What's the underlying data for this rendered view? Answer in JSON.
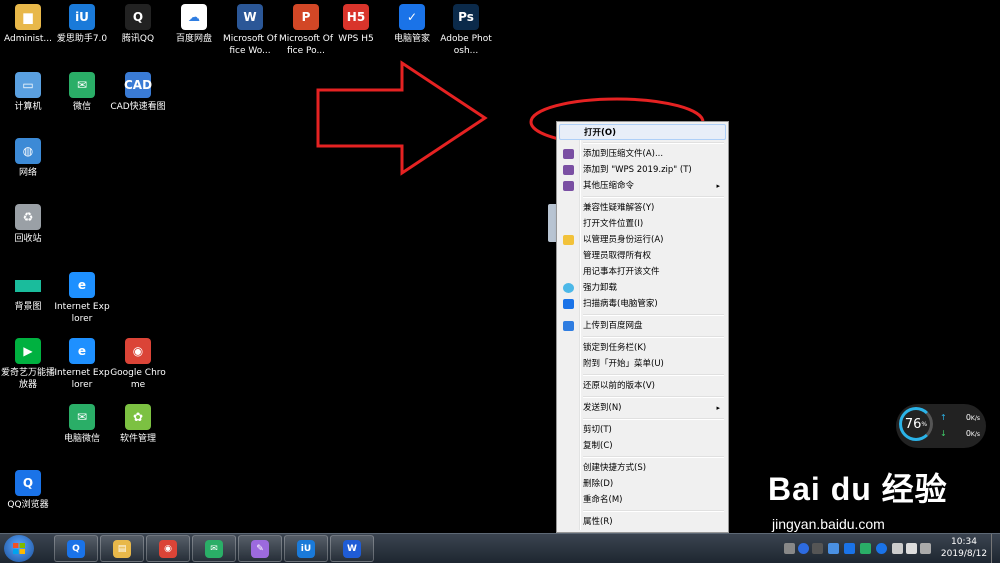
{
  "desktop_icons": [
    {
      "label": "Administ...",
      "icon": "folder-icon",
      "color": "#e8b84a"
    },
    {
      "label": "爱思助手7.0",
      "icon": "i4-icon",
      "color": "#1a7ad9"
    },
    {
      "label": "腾讯QQ",
      "icon": "qq-icon",
      "color": "#222222"
    },
    {
      "label": "百度网盘",
      "icon": "baidu-netdisk-icon",
      "color": "#ffffff"
    },
    {
      "label": "Microsoft Office Wo...",
      "icon": "word-icon",
      "color": "#2b5797"
    },
    {
      "label": "Microsoft Office Po...",
      "icon": "powerpoint-icon",
      "color": "#d24726"
    },
    {
      "label": "WPS H5",
      "icon": "wps-h5-icon",
      "color": "#d9342b"
    },
    {
      "label": "电脑管家",
      "icon": "pc-manager-icon",
      "color": "#1a73e8"
    },
    {
      "label": "Adobe Photosh...",
      "icon": "photoshop-icon",
      "color": "#0b2a4a"
    },
    {
      "label": "计算机",
      "icon": "computer-icon",
      "color": "#5aa0e0"
    },
    {
      "label": "微信",
      "icon": "wechat-icon",
      "color": "#2aae67"
    },
    {
      "label": "CAD快速看图",
      "icon": "cad-icon",
      "color": "#3a7bd5"
    },
    {
      "label": "网络",
      "icon": "network-icon",
      "color": "#3c8ad6"
    },
    {
      "label": "回收站",
      "icon": "recycle-bin-icon",
      "color": "#9aa0a6"
    },
    {
      "label": "背景图",
      "icon": "image-icon",
      "color": "#1abc9c"
    },
    {
      "label": "Internet Explorer",
      "icon": "ie-icon",
      "color": "#1e90ff"
    },
    {
      "label": "爱奇艺万能播放器",
      "icon": "iqiyi-icon",
      "color": "#00b140"
    },
    {
      "label": "Internet Explorer",
      "icon": "ie-icon",
      "color": "#1e90ff"
    },
    {
      "label": "Google Chrome",
      "icon": "chrome-icon",
      "color": "#db4437"
    },
    {
      "label": "电脑微信",
      "icon": "wechat-icon",
      "color": "#2aae67"
    },
    {
      "label": "软件管理",
      "icon": "software-manager-icon",
      "color": "#7cc142"
    },
    {
      "label": "QQ浏览器",
      "icon": "qq-browser-icon",
      "color": "#1a73e8"
    }
  ],
  "context_menu": {
    "items": [
      {
        "label": "打开(O)",
        "bold": true,
        "icon": ""
      },
      {
        "label": "添加到压缩文件(A)...",
        "icon": "winrar-icon"
      },
      {
        "label": "添加到 \"WPS 2019.zip\" (T)",
        "icon": "winrar-icon"
      },
      {
        "label": "其他压缩命令",
        "icon": "winrar-icon",
        "submenu": "▸"
      },
      {
        "label": "兼容性疑难解答(Y)",
        "icon": ""
      },
      {
        "label": "打开文件位置(I)",
        "icon": ""
      },
      {
        "label": "以管理员身份运行(A)",
        "icon": "uac-shield-icon"
      },
      {
        "label": "管理员取得所有权",
        "icon": ""
      },
      {
        "label": "用记事本打开该文件",
        "icon": ""
      },
      {
        "label": "强力卸载",
        "icon": "uninstall-icon"
      },
      {
        "label": "扫描病毒(电脑管家)",
        "icon": "pc-manager-icon"
      },
      {
        "label": "上传到百度网盘",
        "icon": "baidu-netdisk-icon"
      },
      {
        "label": "锁定到任务栏(K)",
        "icon": ""
      },
      {
        "label": "附到「开始」菜单(U)",
        "icon": ""
      },
      {
        "label": "还原以前的版本(V)",
        "icon": ""
      },
      {
        "label": "发送到(N)",
        "icon": "",
        "submenu": "▸"
      },
      {
        "label": "剪切(T)",
        "icon": ""
      },
      {
        "label": "复制(C)",
        "icon": ""
      },
      {
        "label": "创建快捷方式(S)",
        "icon": ""
      },
      {
        "label": "删除(D)",
        "icon": ""
      },
      {
        "label": "重命名(M)",
        "icon": ""
      },
      {
        "label": "属性(R)",
        "icon": ""
      }
    ]
  },
  "speed_widget": {
    "percent": "76",
    "percent_unit": "%",
    "up": "0",
    "up_unit": "K/s",
    "down": "0",
    "down_unit": "K/s",
    "up_arrow": "↑",
    "down_arrow": "↓"
  },
  "watermark": {
    "brand": "Bai du 经验",
    "url": "jingyan.baidu.com"
  },
  "taskbar": {
    "pinned": [
      {
        "name": "qq-browser-icon",
        "color": "#1a73e8",
        "glyph": "Q"
      },
      {
        "name": "explorer-icon",
        "color": "#e8b84a",
        "glyph": "▤"
      },
      {
        "name": "chrome-icon",
        "color": "#db4437",
        "glyph": "◉"
      },
      {
        "name": "wechat-icon",
        "color": "#2aae67",
        "glyph": "✉"
      },
      {
        "name": "paint-icon",
        "color": "#9c6ade",
        "glyph": "✎"
      },
      {
        "name": "i4-icon",
        "color": "#1a7ad9",
        "glyph": "iU"
      },
      {
        "name": "wps-icon",
        "color": "#1f5cd6",
        "glyph": "W"
      }
    ],
    "clock_time": "10:34",
    "clock_date": "2019/8/12"
  },
  "annotation": {
    "arrow_color": "#e52222",
    "ellipse_color": "#e52222"
  }
}
